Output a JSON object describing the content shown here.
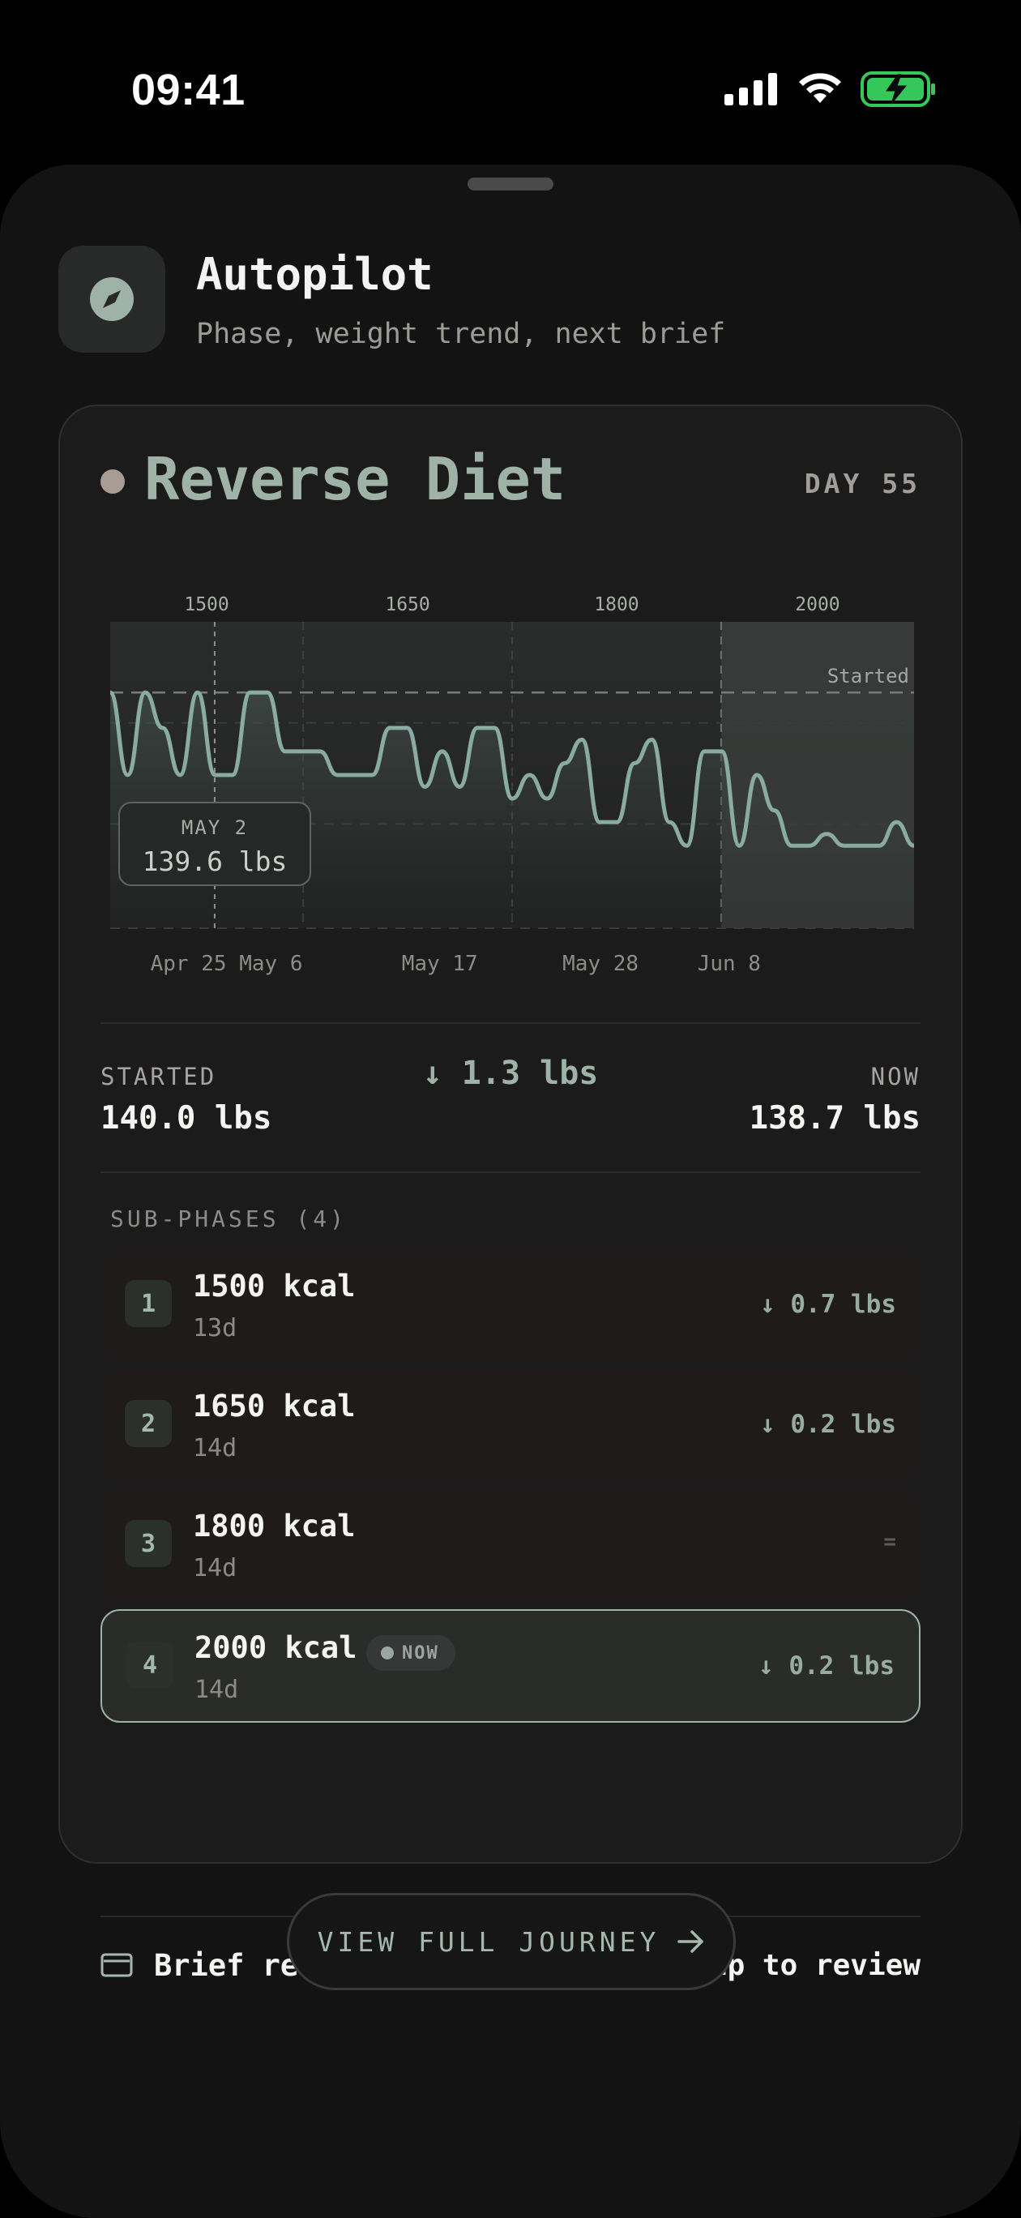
{
  "status_bar": {
    "time": "09:41"
  },
  "header": {
    "title": "Autopilot",
    "subtitle": "Phase, weight trend, next brief",
    "icon": "compass-icon"
  },
  "phase": {
    "title": "Reverse Diet",
    "day_label": "DAY 55",
    "dot_color": "#a89c94"
  },
  "tooltip": {
    "date": "MAY 2",
    "value": "139.6 lbs"
  },
  "chart_data": {
    "type": "line",
    "unit": "lbs",
    "phase_labels": [
      "1500",
      "1650",
      "1800",
      "2000"
    ],
    "x_tick_labels": [
      "Apr 25",
      "May 6",
      "May 17",
      "May 28",
      "Jun 8"
    ],
    "reference_line": {
      "label": "Started",
      "value": 140.0
    },
    "y_range": [
      138.0,
      140.6
    ],
    "highlight_point": {
      "date": "May 2",
      "value": 139.6
    },
    "series": [
      {
        "values": [
          140.0,
          139.3,
          140.0,
          139.7,
          139.3,
          140.0,
          139.3,
          139.3,
          140.0,
          140.0,
          139.5,
          139.5,
          139.5,
          139.3,
          139.3,
          139.3,
          139.7,
          139.7,
          139.2,
          139.5,
          139.2,
          139.7,
          139.7,
          139.1,
          139.3,
          139.1,
          139.4,
          139.6,
          138.9,
          138.9,
          139.4,
          139.6,
          138.9,
          138.7,
          139.5,
          139.5,
          138.7,
          139.3,
          139.0,
          138.7,
          138.7,
          138.8,
          138.7,
          138.7,
          138.7,
          138.9,
          138.7
        ]
      }
    ],
    "colors": {
      "line": "#89aba2",
      "now_band": "#3a3d3b"
    }
  },
  "stats": {
    "started_label": "STARTED",
    "started_value": "140.0 lbs",
    "change": "↓ 1.3 lbs",
    "now_label": "NOW",
    "now_value": "138.7 lbs"
  },
  "sub_phases": {
    "heading": "SUB-PHASES (4)",
    "items": [
      {
        "num": "1",
        "kcal": "1500 kcal",
        "days": "13d",
        "delta": "↓ 0.7 lbs"
      },
      {
        "num": "2",
        "kcal": "1650 kcal",
        "days": "14d",
        "delta": "↓ 0.2 lbs"
      },
      {
        "num": "3",
        "kcal": "1800 kcal",
        "days": "14d",
        "delta": "="
      },
      {
        "num": "4",
        "kcal": "2000 kcal",
        "days": "14d",
        "delta": "↓ 0.2 lbs",
        "badge": "NOW"
      }
    ]
  },
  "brief": {
    "label": "Brief ready",
    "cta": "Tap to review"
  },
  "journey_button": {
    "label": "VIEW FULL JOURNEY"
  }
}
